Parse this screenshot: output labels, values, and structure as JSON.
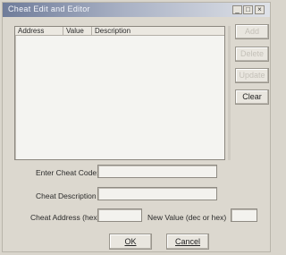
{
  "window": {
    "title": "Cheat Edit and Editor",
    "controls": [
      "_",
      "□",
      "×"
    ]
  },
  "list": {
    "columns": [
      "Address",
      "Value",
      "Description"
    ],
    "rows": []
  },
  "side_buttons": {
    "add": "Add",
    "delete": "Delete",
    "update": "Update",
    "clear": "Clear"
  },
  "form": {
    "cheat_code_label": "Enter Cheat Code:",
    "cheat_code_value": "",
    "cheat_description_label": "Cheat Description",
    "cheat_description_value": "",
    "cheat_address_label": "Cheat Address (hex)",
    "cheat_address_value": "",
    "new_value_label": "New Value (dec or hex)",
    "new_value_value": ""
  },
  "footer": {
    "ok_label": "OK",
    "cancel_label": "Cancel"
  }
}
